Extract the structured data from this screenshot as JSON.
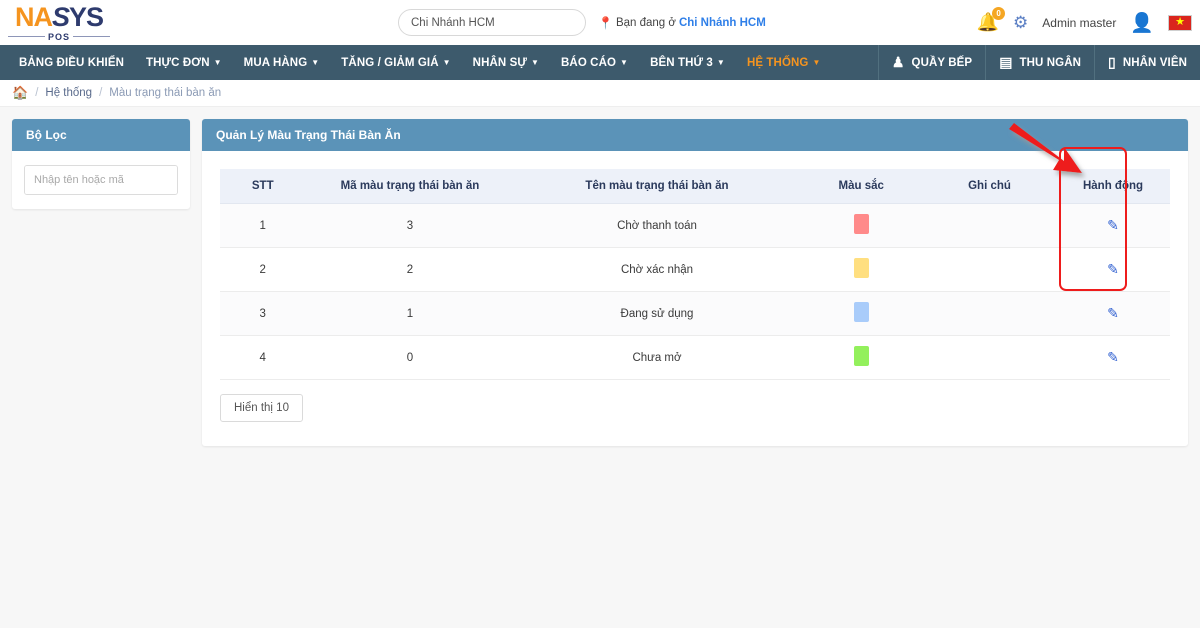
{
  "brand": {
    "logo_na": "NA",
    "logo_s": "S",
    "logo_ys": "YS",
    "logo_sub": "POS"
  },
  "header": {
    "branch_input_value": "Chi Nhánh HCM",
    "branch_input_placeholder": "Chi Nhánh HCM",
    "location_icon": "location-pin-icon",
    "branch_note_prefix": "Bạn đang ở",
    "branch_note_name": "Chi Nhánh HCM",
    "bell_icon": "bell-icon",
    "notification_count": "0",
    "gear_icon": "gear-icon",
    "user_name": "Admin master",
    "avatar_icon": "user-avatar-icon",
    "flag_icon": "vietnam-flag-icon",
    "flag_star": "★"
  },
  "nav": {
    "items": [
      {
        "label": "BẢNG ĐIỀU KHIỂN",
        "caret": false,
        "active": false
      },
      {
        "label": "THỰC ĐƠN",
        "caret": true,
        "active": false
      },
      {
        "label": "MUA HÀNG",
        "caret": true,
        "active": false
      },
      {
        "label": "TĂNG / GIẢM GIÁ",
        "caret": true,
        "active": false
      },
      {
        "label": "NHÂN SỰ",
        "caret": true,
        "active": false
      },
      {
        "label": "BÁO CÁO",
        "caret": true,
        "active": false
      },
      {
        "label": "BÊN THỨ 3",
        "caret": true,
        "active": false
      },
      {
        "label": "HỆ THỐNG",
        "caret": true,
        "active": true
      }
    ],
    "right_items": [
      {
        "label": "QUẦY BẾP",
        "icon": "chef-hat-icon",
        "glyph": "♟"
      },
      {
        "label": "THU NGÂN",
        "icon": "cash-register-icon",
        "glyph": "▤"
      },
      {
        "label": "NHÂN VIÊN",
        "icon": "clipboard-icon",
        "glyph": "▯"
      }
    ]
  },
  "breadcrumb": {
    "home_icon": "home-icon",
    "sep": "/",
    "parent": "Hệ thống",
    "current": "Màu trạng thái bàn ăn"
  },
  "filter": {
    "title": "Bộ Lọc",
    "search_placeholder": "Nhập tên hoặc mã",
    "search_value": "",
    "search_icon": "search-icon"
  },
  "main": {
    "title": "Quản Lý Màu Trạng Thái Bàn Ăn",
    "columns": [
      "STT",
      "Mã màu trạng thái bàn ăn",
      "Tên màu trạng thái bàn ăn",
      "Màu sắc",
      "Ghi chú",
      "Hành động"
    ],
    "rows": [
      {
        "stt": "1",
        "code": "3",
        "name": "Chờ thanh toán",
        "color": "#FF8A8A",
        "note": "",
        "action_icon": "edit-pencil-icon"
      },
      {
        "stt": "2",
        "code": "2",
        "name": "Chờ xác nhận",
        "color": "#FFDF80",
        "note": "",
        "action_icon": "edit-pencil-icon"
      },
      {
        "stt": "3",
        "code": "1",
        "name": "Đang sử dụng",
        "color": "#A9CCFA",
        "note": "",
        "action_icon": "edit-pencil-icon"
      },
      {
        "stt": "4",
        "code": "0",
        "name": "Chưa mở",
        "color": "#93F05C",
        "note": "",
        "action_icon": "edit-pencil-icon"
      }
    ],
    "pager_label": "Hiển thị 10"
  },
  "annotations": {
    "arrow_color": "#ee1c1c",
    "highlight_color": "#ee1c1c",
    "arrow_name": "red-pointer-arrow",
    "highlight_name": "action-column-highlight"
  },
  "theme": {
    "nav_bg": "#3d5a6c",
    "panel_head_bg": "#5b93b8",
    "accent_orange": "#f5941f",
    "link_blue": "#2f7fe8",
    "page_bg": "#f7f7f7"
  }
}
